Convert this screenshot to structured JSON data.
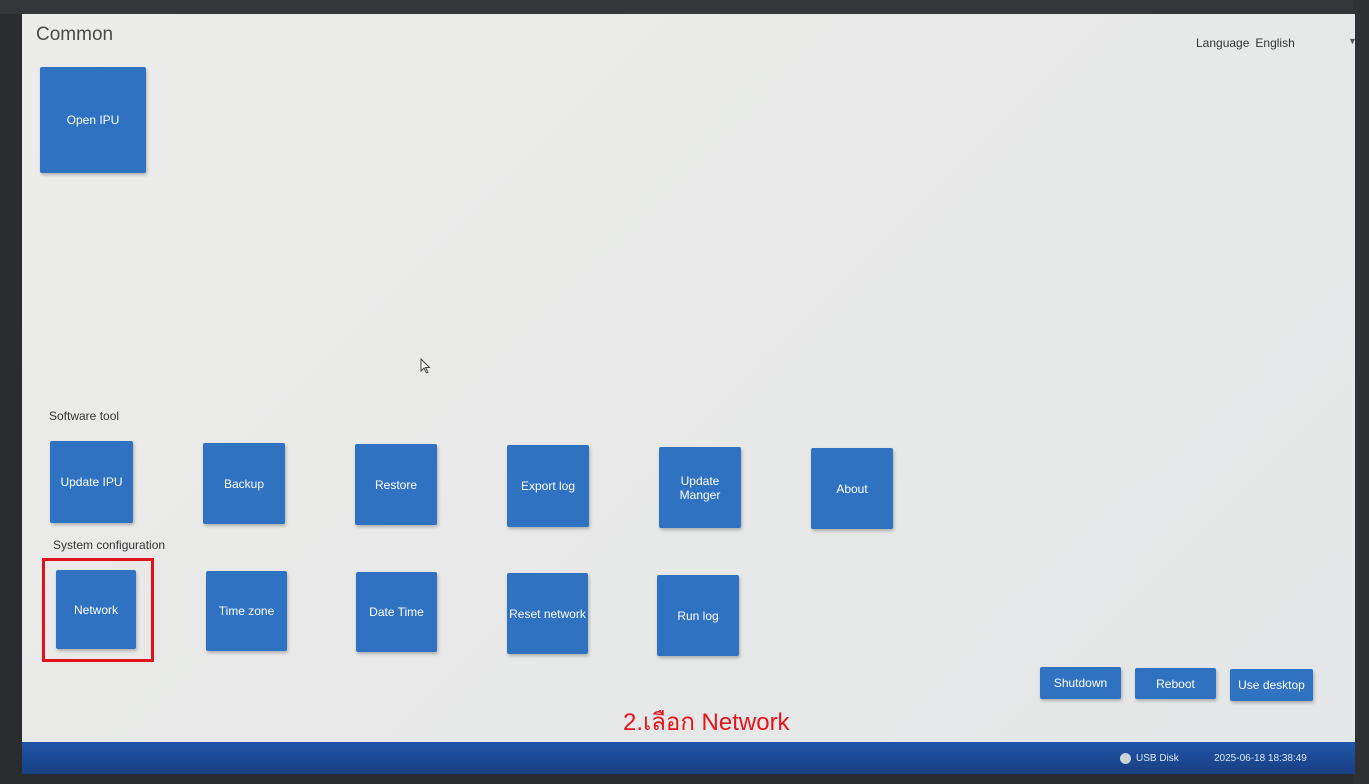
{
  "header": {
    "title": "Common",
    "language_label": "Language",
    "language_value": "English"
  },
  "common": {
    "open_ipu": "Open IPU"
  },
  "software_tool": {
    "label": "Software tool",
    "items": [
      "Update IPU",
      "Backup",
      "Restore",
      "Export log",
      "Update Manger",
      "About"
    ]
  },
  "system_configuration": {
    "label": "System configuration",
    "items": [
      "Network",
      "Time zone",
      "Date Time",
      "Reset network",
      "Run log"
    ]
  },
  "power": {
    "shutdown": "Shutdown",
    "reboot": "Reboot",
    "use_desktop": "Use desktop"
  },
  "annotation": {
    "text": "2.เลือก Network",
    "color": "#e8141b"
  },
  "taskbar": {
    "usb_label": "USB Disk",
    "datetime": "2025-06-18 18:38:49"
  },
  "colors": {
    "tile": "#2f72c2",
    "taskbar": "#1f55a8"
  }
}
